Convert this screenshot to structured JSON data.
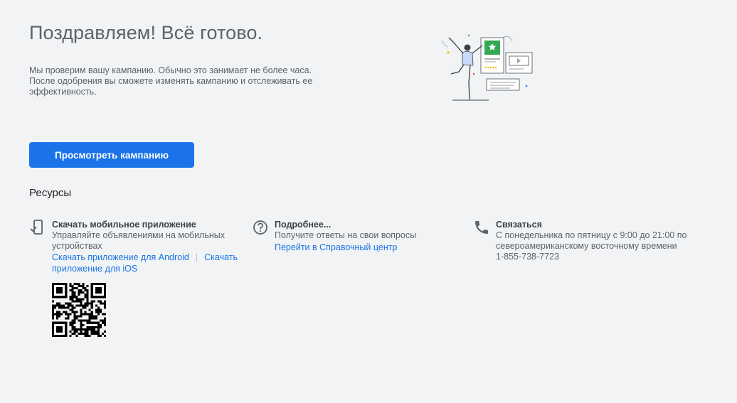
{
  "header": {
    "title": "Поздравляем! Всё готово.",
    "description_line1": "Мы проверим вашу кампанию. Обычно это занимает не более часа.",
    "description_line2": "После одобрения вы сможете изменять кампанию и отслеживать ее эффективность."
  },
  "primary_button_label": "Просмотреть кампанию",
  "resources": {
    "title": "Ресурсы",
    "mobile_app": {
      "title": "Скачать мобильное приложение",
      "text": "Управляйте объявлениями на мобильных устройствах",
      "android_link": "Скачать приложение для Android",
      "separator": "|",
      "ios_link": "Скачать приложение для iOS"
    },
    "learn_more": {
      "title": "Подробнее...",
      "text": "Получите ответы на свои вопросы",
      "link": "Перейти в Справочный центр"
    },
    "contact": {
      "title": "Связаться",
      "hours": "С понедельника по пятницу с 9:00 до 21:00 по североамериканскому восточному времени",
      "phone": "1-855-738-7723"
    }
  },
  "colors": {
    "accent": "#1a73e8",
    "background": "#f1f3f4",
    "illustration_green": "#34a853"
  },
  "icons": [
    "mobile-phone-icon",
    "help-circle-icon",
    "phone-icon",
    "qr-code-icon"
  ]
}
